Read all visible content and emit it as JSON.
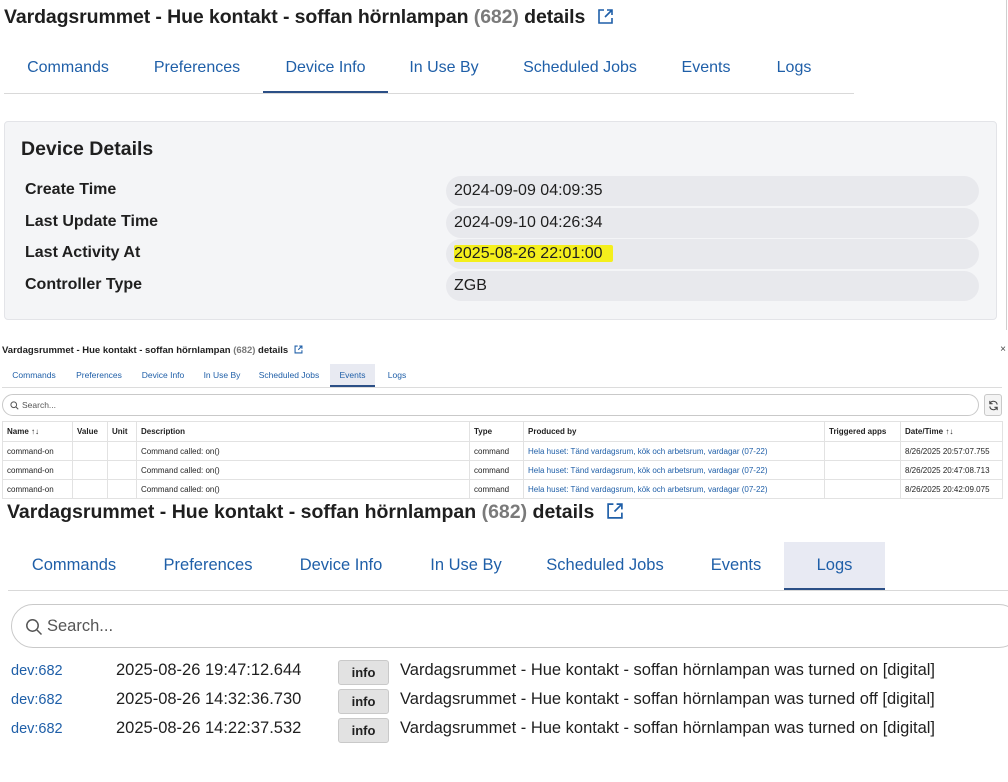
{
  "device": {
    "title_prefix": "Vardagsrummet - Hue kontakt - soffan hörnlampan",
    "id_text": "(682)",
    "title_suffix": "details"
  },
  "tabs": [
    "Commands",
    "Preferences",
    "Device Info",
    "In Use By",
    "Scheduled Jobs",
    "Events",
    "Logs"
  ],
  "device_info": {
    "heading": "Device Details",
    "rows": [
      {
        "label": "Create Time",
        "value": "2024-09-09 04:09:35"
      },
      {
        "label": "Last Update Time",
        "value": "2024-09-10 04:26:34"
      },
      {
        "label": "Last Activity At",
        "value": "2025-08-26 22:01:00"
      },
      {
        "label": "Controller Type",
        "value": "ZGB"
      }
    ],
    "highlight_color": "#f4ef1c"
  },
  "events": {
    "close_glyph": "×",
    "search_placeholder": "Search...",
    "columns": [
      "Name ↑↓",
      "Value",
      "Unit",
      "Description",
      "Type",
      "Produced by",
      "Triggered apps",
      "Date/Time ↑↓"
    ],
    "rows": [
      {
        "name": "command-on",
        "value": "",
        "unit": "",
        "description": "Command called: on()",
        "type": "command",
        "produced_by": "Hela huset: Tänd vardagsrum, kök och arbetsrum, vardagar (07-22)",
        "triggered": "",
        "datetime": "8/26/2025 20:57:07.755"
      },
      {
        "name": "command-on",
        "value": "",
        "unit": "",
        "description": "Command called: on()",
        "type": "command",
        "produced_by": "Hela huset: Tänd vardagsrum, kök och arbetsrum, vardagar (07-22)",
        "triggered": "",
        "datetime": "8/26/2025 20:47:08.713"
      },
      {
        "name": "command-on",
        "value": "",
        "unit": "",
        "description": "Command called: on()",
        "type": "command",
        "produced_by": "Hela huset: Tänd vardagsrum, kök och arbetsrum, vardagar (07-22)",
        "triggered": "",
        "datetime": "8/26/2025 20:42:09.075"
      }
    ]
  },
  "logs": {
    "search_placeholder": "Search...",
    "entries": [
      {
        "dev": "dev:682",
        "time": "2025-08-26 19:47:12.644",
        "level": "info",
        "message": "Vardagsrummet - Hue kontakt - soffan hörnlampan was turned on [digital]"
      },
      {
        "dev": "dev:682",
        "time": "2025-08-26 14:32:36.730",
        "level": "info",
        "message": "Vardagsrummet - Hue kontakt - soffan hörnlampan was turned off [digital]"
      },
      {
        "dev": "dev:682",
        "time": "2025-08-26 14:22:37.532",
        "level": "info",
        "message": "Vardagsrummet - Hue kontakt - soffan hörnlampan was turned on [digital]"
      }
    ]
  },
  "colors": {
    "link_blue": "#1f5fa8",
    "tab_underline": "#2b4f86",
    "card_bg": "#f4f5f7"
  }
}
